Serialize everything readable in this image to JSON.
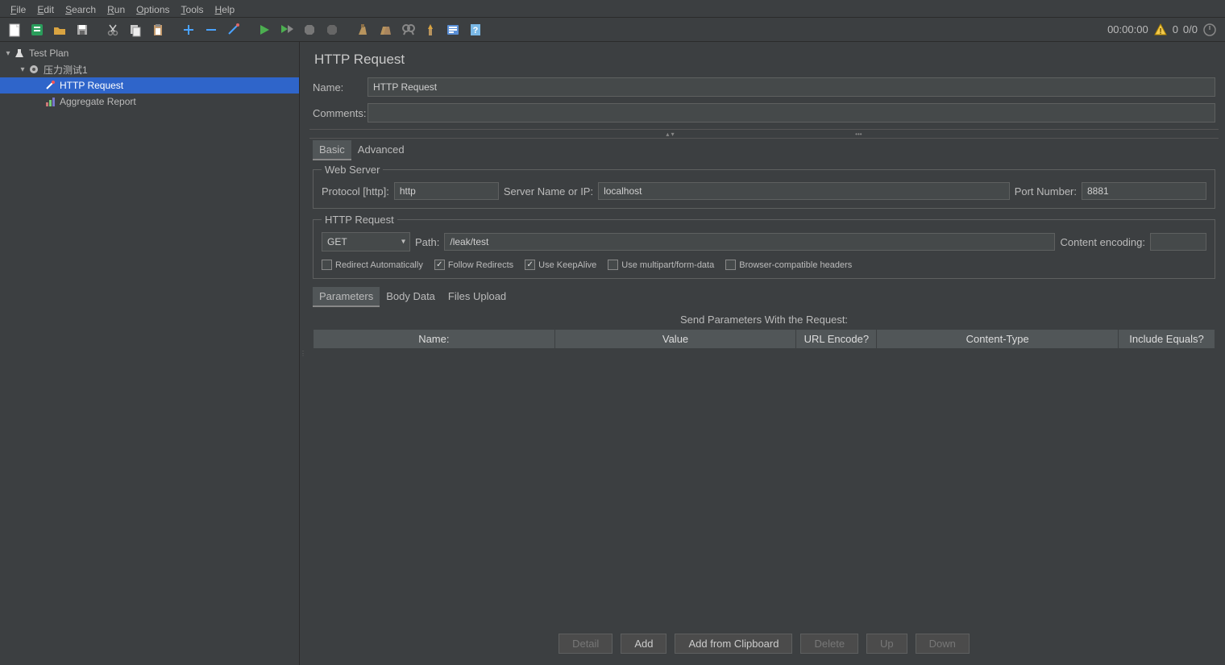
{
  "menubar": {
    "items": [
      "File",
      "Edit",
      "Search",
      "Run",
      "Options",
      "Tools",
      "Help"
    ]
  },
  "status": {
    "time": "00:00:00",
    "active": "0",
    "threads": "0/0"
  },
  "tree": {
    "root": {
      "label": "Test Plan"
    },
    "group": {
      "label": "压力测试1"
    },
    "item1": {
      "label": "HTTP Request"
    },
    "item2": {
      "label": "Aggregate Report"
    }
  },
  "panel": {
    "title": "HTTP Request",
    "name_label": "Name:",
    "name_value": "HTTP Request",
    "comments_label": "Comments:",
    "comments_value": ""
  },
  "tabs": {
    "basic": "Basic",
    "advanced": "Advanced"
  },
  "web_server": {
    "legend": "Web Server",
    "protocol_label": "Protocol [http]:",
    "protocol_value": "http",
    "server_label": "Server Name or IP:",
    "server_value": "localhost",
    "port_label": "Port Number:",
    "port_value": "8881"
  },
  "http_request": {
    "legend": "HTTP Request",
    "method": "GET",
    "path_label": "Path:",
    "path_value": "/leak/test",
    "encoding_label": "Content encoding:",
    "encoding_value": ""
  },
  "checks": {
    "redirect_auto": "Redirect Automatically",
    "follow_redirects": "Follow Redirects",
    "keepalive": "Use KeepAlive",
    "multipart": "Use multipart/form-data",
    "browser_compat": "Browser-compatible headers"
  },
  "ptabs": {
    "params": "Parameters",
    "body": "Body Data",
    "files": "Files Upload"
  },
  "params_heading": "Send Parameters With the Request:",
  "columns": {
    "name": "Name:",
    "value": "Value",
    "urlenc": "URL Encode?",
    "ctype": "Content-Type",
    "inceq": "Include Equals?"
  },
  "buttons": {
    "detail": "Detail",
    "add": "Add",
    "add_clip": "Add from Clipboard",
    "delete": "Delete",
    "up": "Up",
    "down": "Down"
  }
}
